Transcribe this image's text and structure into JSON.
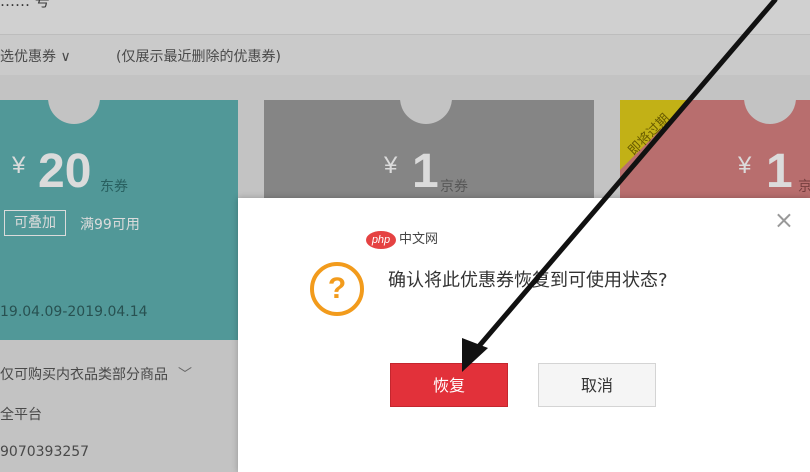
{
  "header": {
    "partial_title": "…… 号"
  },
  "filter": {
    "select_label": "选优惠券 ∨",
    "note": "(仅展示最近删除的优惠券)"
  },
  "coupons": [
    {
      "currency": "¥",
      "amount": "20",
      "type": "东券",
      "stack_badge": "可叠加",
      "threshold": "满99可用",
      "validity": "19.04.09-2019.04.14"
    },
    {
      "currency": "¥",
      "amount": "1",
      "type": "京券"
    },
    {
      "currency": "¥",
      "amount": "1",
      "type": "京",
      "flag": "即将过期"
    }
  ],
  "coupon_detail": {
    "scope": "仅可购买内衣品类部分商品",
    "platform": "全平台",
    "code": "9070393257"
  },
  "dialog": {
    "watermark_logo": "php",
    "watermark_text": "中文网",
    "question_mark": "?",
    "message": "确认将此优惠券恢复到可使用状态?",
    "confirm_label": "恢复",
    "cancel_label": "取消",
    "close_symbol": "×"
  },
  "colors": {
    "coupon_teal": "#5fb2b2",
    "coupon_gray": "#9b9b9b",
    "coupon_red": "#d78080",
    "flag_yellow": "#e2cf1a",
    "confirm_red": "#e2313a",
    "warning_orange": "#f29b1c"
  },
  "icons": [
    "question-icon",
    "close-icon",
    "chevron-down-icon",
    "annotation-arrow"
  ]
}
